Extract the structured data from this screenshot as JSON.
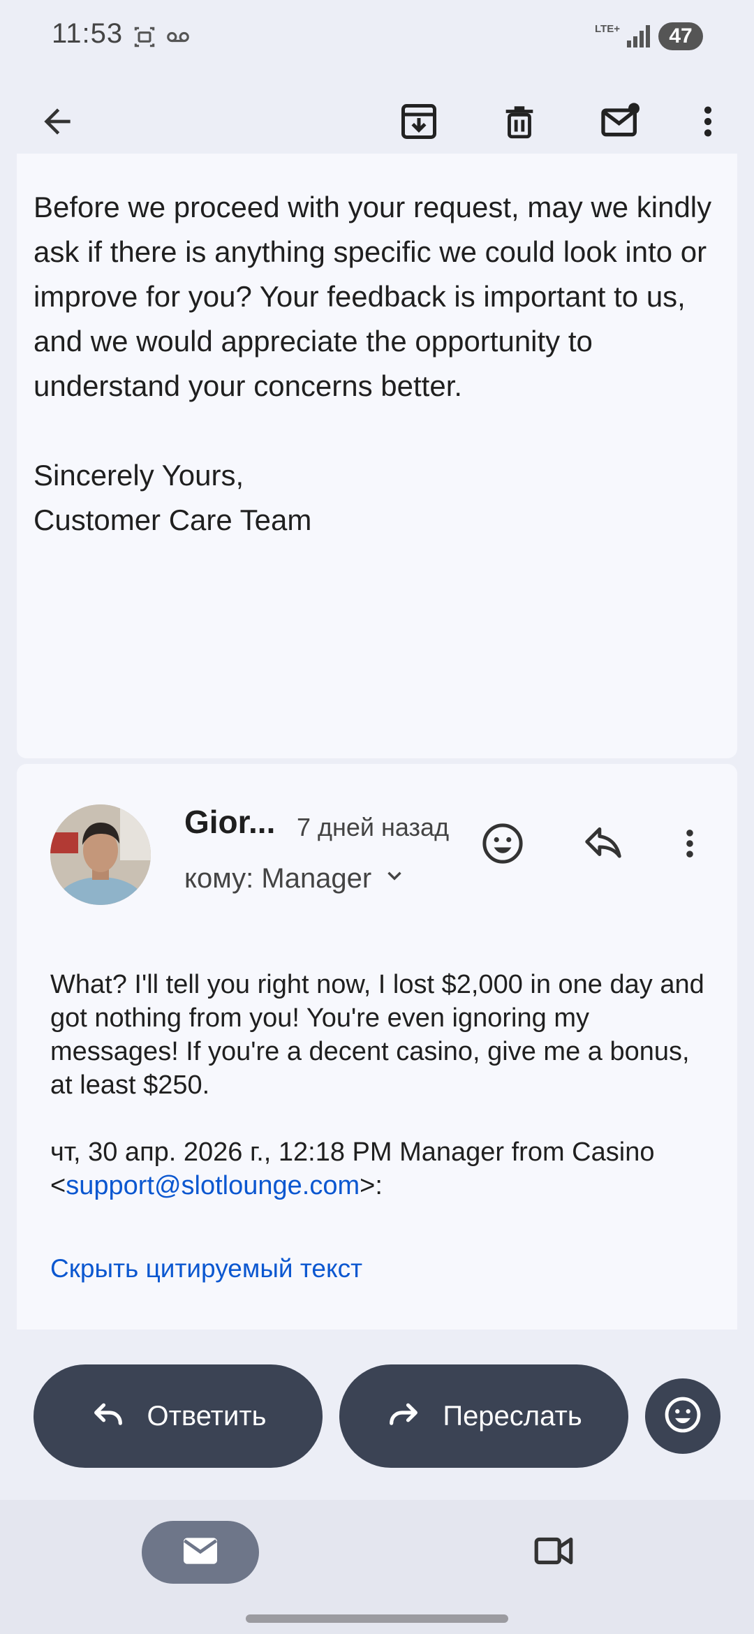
{
  "status_bar": {
    "time": "11:53",
    "network": "LTE+",
    "battery": "47",
    "icons": [
      "screenshot-icon",
      "voicemail-icon",
      "signal-icon"
    ]
  },
  "toolbar": {
    "icons": [
      "back-arrow-icon",
      "archive-icon",
      "delete-icon",
      "mark-unread-icon",
      "more-vert-icon"
    ]
  },
  "email1": {
    "paragraph": "Before we proceed with your request, may we kindly ask if there is anything specific we could look into or improve for you? Your feedback is important to us, and we would appreciate the opportunity to understand your concerns better.",
    "closing": "Sincerely Yours,",
    "signature": "Customer Care Team"
  },
  "email2": {
    "sender": "Gior...",
    "date": "7 дней назад",
    "to_label": "кому: Manager",
    "body": "What? I'll tell you right now, I lost $2,000 in one day and got nothing from you! You're even ignoring my messages! If you're a decent casino, give me a bonus, at least $250.",
    "quote_header_pre": "чт, 30 апр. 2026 г., 12:18 PM Manager from Casino <",
    "quote_email": "support@slotlounge.com",
    "quote_header_post": ">:",
    "hide_quoted": "Скрыть цитируемый текст"
  },
  "actions": {
    "reply": "Ответить",
    "forward": "Переслать"
  },
  "colors": {
    "link": "#0b57d0",
    "pill": "#3b4354",
    "background": "#eceef6",
    "card": "#f7f8fd"
  }
}
